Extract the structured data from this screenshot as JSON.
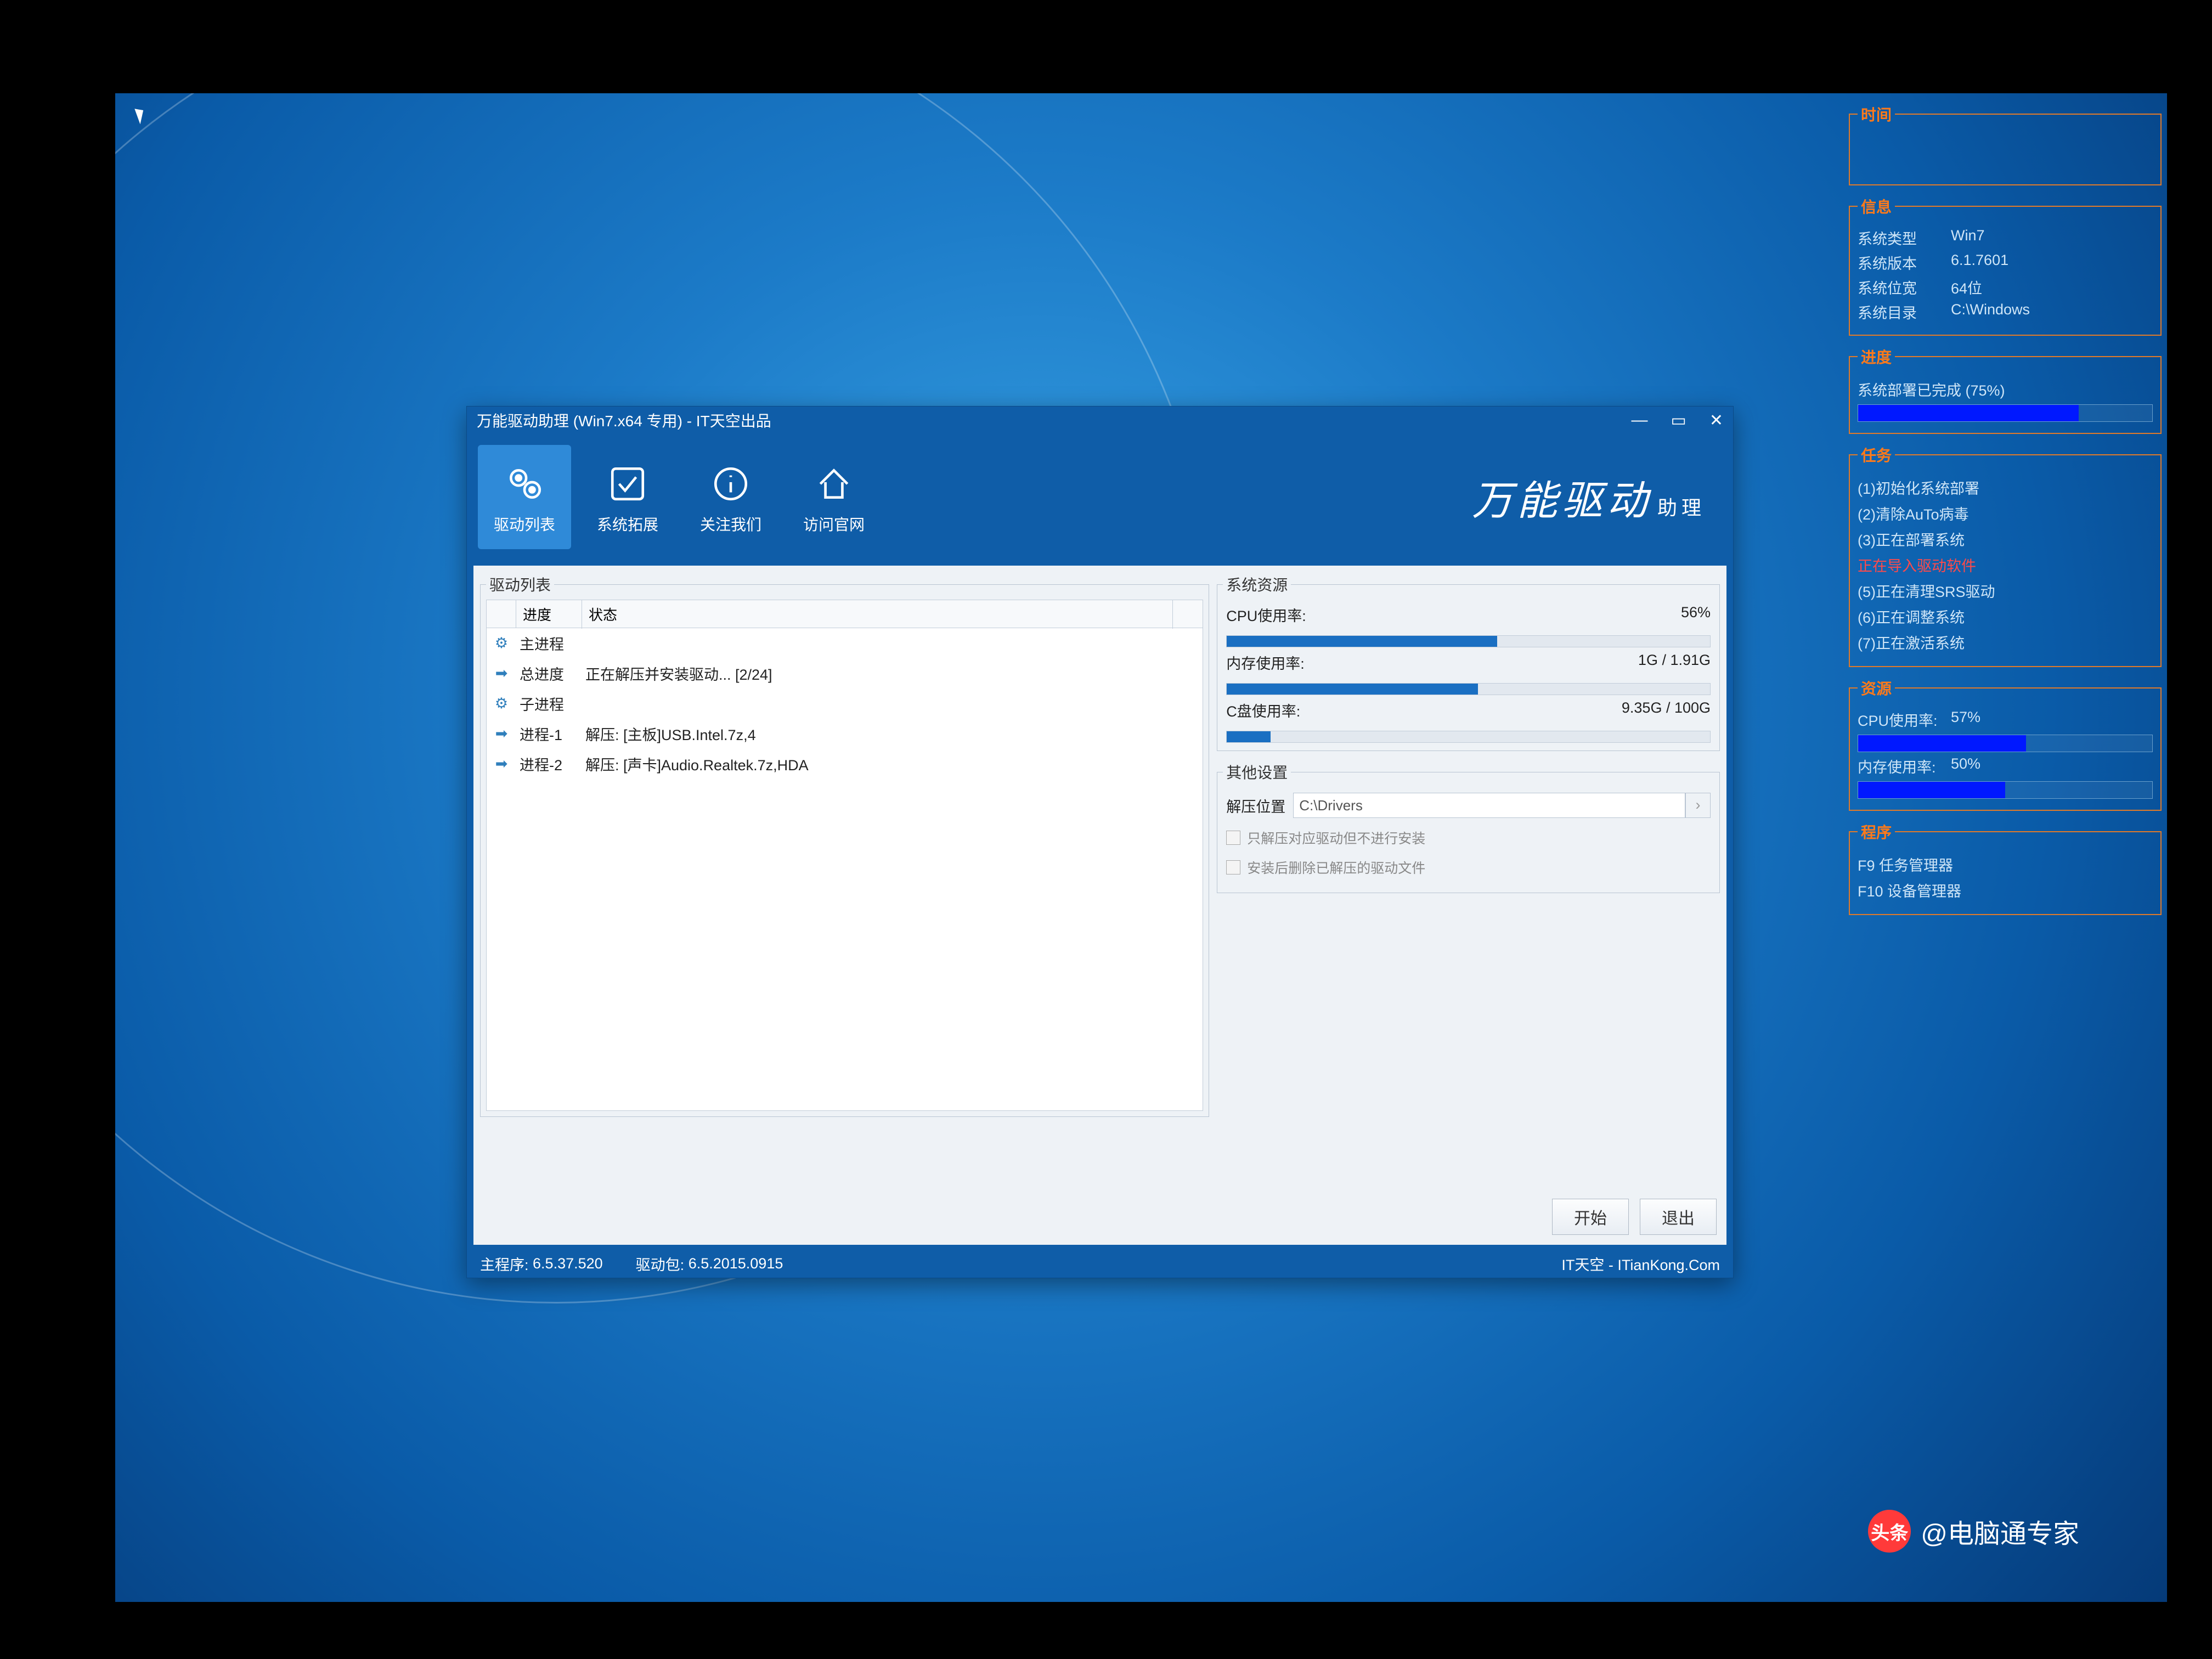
{
  "app": {
    "title": "万能驱动助理 (Win7.x64 专用) - IT天空出品",
    "window_controls": {
      "min": "—",
      "float": "▭",
      "close": "✕"
    },
    "toolbar": [
      {
        "label": "驱动列表",
        "icon": "gears-icon",
        "active": true
      },
      {
        "label": "系统拓展",
        "icon": "check-icon"
      },
      {
        "label": "关注我们",
        "icon": "info-icon"
      },
      {
        "label": "访问官网",
        "icon": "home-icon"
      }
    ],
    "brand": {
      "main": "万能驱动",
      "sub": "助理"
    }
  },
  "driver_list": {
    "legend": "驱动列表",
    "headers": {
      "progress": "进度",
      "status": "状态"
    },
    "rows": [
      {
        "icon": "gear",
        "label": "主进程",
        "status": ""
      },
      {
        "icon": "arrow",
        "label": "总进度",
        "status": "正在解压并安装驱动... [2/24]"
      },
      {
        "icon": "gear",
        "label": "子进程",
        "status": ""
      },
      {
        "icon": "arrow",
        "label": "进程-1",
        "status": "解压: [主板]USB.Intel.7z,4"
      },
      {
        "icon": "arrow",
        "label": "进程-2",
        "status": "解压: [声卡]Audio.Realtek.7z,HDA"
      }
    ]
  },
  "resources": {
    "legend": "系统资源",
    "items": [
      {
        "label": "CPU使用率:",
        "value": "56%",
        "pct": 56
      },
      {
        "label": "内存使用率:",
        "value": "1G / 1.91G",
        "pct": 52
      },
      {
        "label": "C盘使用率:",
        "value": "9.35G / 100G",
        "pct": 9
      }
    ]
  },
  "settings": {
    "legend": "其他设置",
    "path_label": "解压位置",
    "path_value": "C:\\Drivers",
    "chk1": "只解压对应驱动但不进行安装",
    "chk2": "安装后删除已解压的驱动文件"
  },
  "buttons": {
    "start": "开始",
    "exit": "退出"
  },
  "statusbar": {
    "main_ver_label": "主程序:",
    "main_ver": "6.5.37.520",
    "pack_ver_label": "驱动包:",
    "pack_ver": "6.5.2015.0915",
    "site": "IT天空 - ITianKong.Com"
  },
  "overlay": {
    "time": {
      "legend": "时间"
    },
    "info": {
      "legend": "信息",
      "rows": [
        {
          "k": "系统类型",
          "v": "Win7"
        },
        {
          "k": "系统版本",
          "v": "6.1.7601"
        },
        {
          "k": "系统位宽",
          "v": "64位"
        },
        {
          "k": "系统目录",
          "v": "C:\\Windows"
        }
      ]
    },
    "progress": {
      "legend": "进度",
      "text": "系统部署已完成 (75%)",
      "pct": 75
    },
    "tasks": {
      "legend": "任务",
      "items": [
        {
          "t": "(1)初始化系统部署"
        },
        {
          "t": "(2)清除AuTo病毒"
        },
        {
          "t": "(3)正在部署系统"
        },
        {
          "t": "  正在导入驱动软件",
          "active": true
        },
        {
          "t": "(5)正在清理SRS驱动"
        },
        {
          "t": "(6)正在调整系统"
        },
        {
          "t": "(7)正在激活系统"
        }
      ]
    },
    "res": {
      "legend": "资源",
      "cpu_label": "CPU使用率:",
      "cpu_val": "57%",
      "cpu_pct": 57,
      "mem_label": "内存使用率:",
      "mem_val": "50%",
      "mem_pct": 50
    },
    "prog": {
      "legend": "程序",
      "items": [
        {
          "t": "F9  任务管理器"
        },
        {
          "t": "F10 设备管理器"
        }
      ]
    }
  },
  "watermark": {
    "logo": "头条",
    "text": "@电脑通专家"
  }
}
